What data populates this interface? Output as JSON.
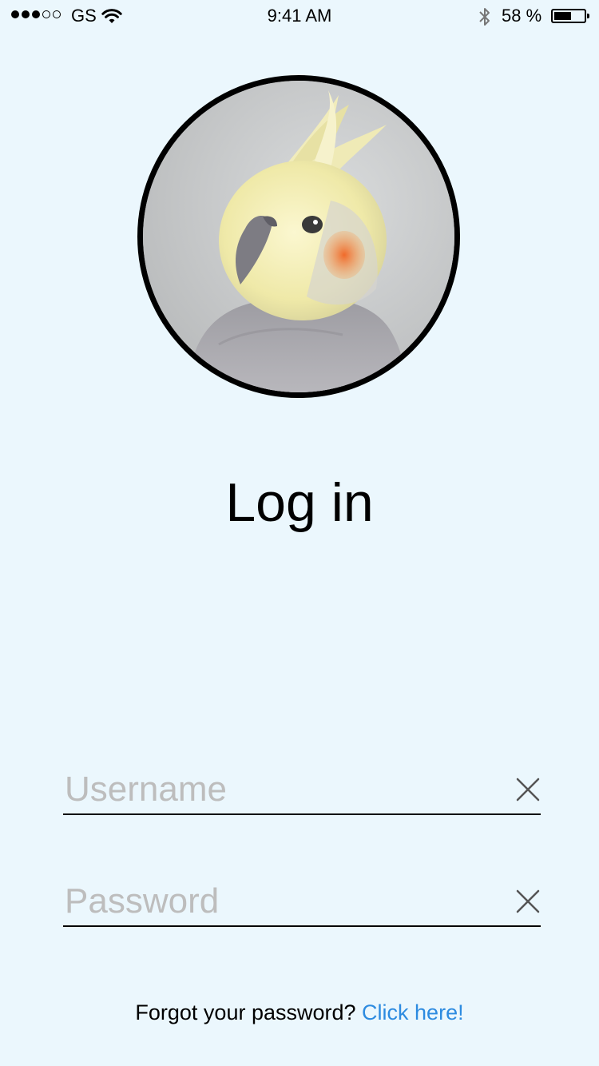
{
  "status_bar": {
    "carrier": "GS",
    "time": "9:41 AM",
    "battery_percent": "58 %",
    "battery_level": 0.58,
    "signal_strength": 3,
    "signal_max": 5
  },
  "avatar": {
    "icon": "cockatiel-photo"
  },
  "title": "Log in",
  "form": {
    "username": {
      "value": "",
      "placeholder": "Username"
    },
    "password": {
      "value": "",
      "placeholder": "Password"
    }
  },
  "forgot": {
    "text": "Forgot your password?",
    "link": "Click here!"
  },
  "colors": {
    "background": "#ebf7fd",
    "link": "#2d8be0",
    "placeholder": "#bdbdbd"
  }
}
